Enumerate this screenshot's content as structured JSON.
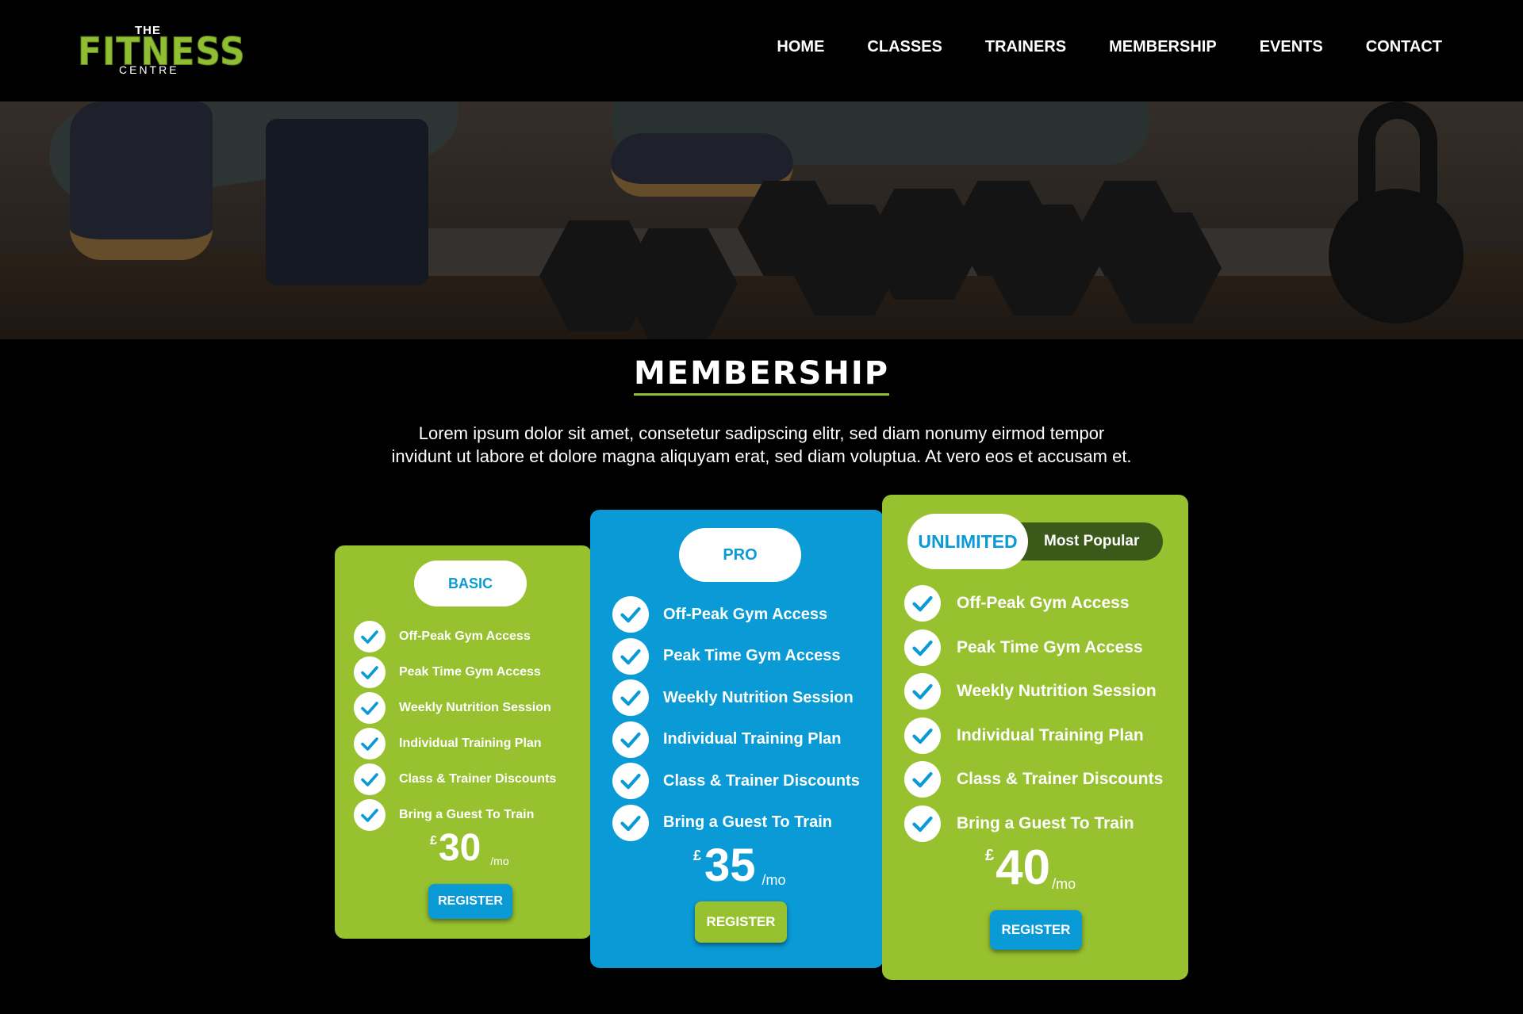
{
  "brand": {
    "the": "THE",
    "name": "FITNESS",
    "sub": "CENTRE"
  },
  "nav": [
    "HOME",
    "CLASSES",
    "TRAINERS",
    "MEMBERSHIP",
    "EVENTS",
    "CONTACT"
  ],
  "section": {
    "title": "MEMBERSHIP",
    "intro_line1": "Lorem ipsum dolor sit amet, consetetur sadipscing elitr, sed diam nonumy eirmod tempor",
    "intro_line2": "invidunt ut labore et dolore magna aliquyam erat, sed diam voluptua. At vero eos et accusam et."
  },
  "plans": [
    {
      "name": "BASIC",
      "features": [
        "Off-Peak Gym Access",
        "Peak Time Gym Access",
        "Weekly Nutrition Session",
        "Individual Training Plan",
        "Class & Trainer Discounts",
        "Bring a Guest To Train"
      ],
      "currency": "£",
      "price": "30",
      "period": "/mo",
      "button": "REGISTER"
    },
    {
      "name": "PRO",
      "features": [
        "Off-Peak Gym Access",
        "Peak Time Gym Access",
        "Weekly Nutrition Session",
        "Individual Training Plan",
        "Class & Trainer Discounts",
        "Bring a Guest To Train"
      ],
      "currency": "£",
      "price": "35",
      "period": "/mo",
      "button": "REGISTER"
    },
    {
      "name": "UNLIMITED",
      "badge": "Most Popular",
      "features": [
        "Off-Peak Gym Access",
        "Peak Time Gym Access",
        "Weekly Nutrition Session",
        "Individual Training Plan",
        "Class & Trainer Discounts",
        "Bring a Guest To Train"
      ],
      "currency": "£",
      "price": "40",
      "period": "/mo",
      "button": "REGISTER"
    }
  ],
  "colors": {
    "green": "#97c12f",
    "blue": "#0a9ad6",
    "dark_green": "#3b5a19",
    "background": "#000000"
  },
  "icons": {
    "feature": "check-circle-icon"
  }
}
